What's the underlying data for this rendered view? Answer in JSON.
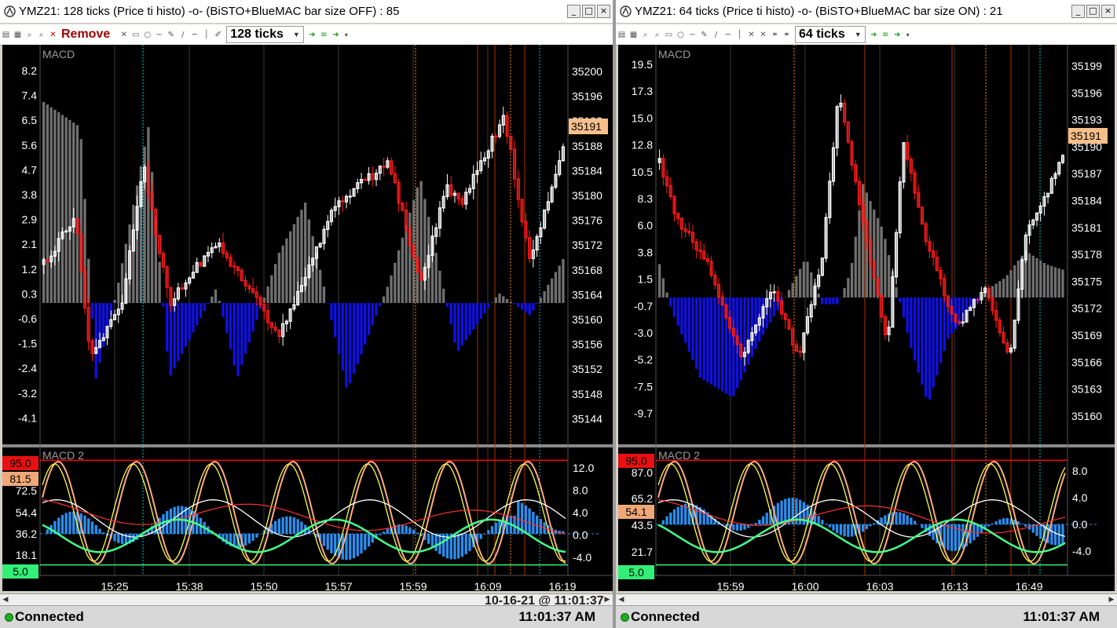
{
  "colors": {
    "bull": "#ffffff",
    "bear": "#ff1a1a",
    "hist_pos": "#707070",
    "hist_neg": "#1010e6",
    "hist2": "#2a8ef0",
    "grid": "#3a3a3a",
    "axis_text": "#ffffff",
    "price_tag_bg": "#f7c08a",
    "upper": "#ff0000",
    "lower": "#33ee77"
  },
  "windows": [
    {
      "title": "YMZ21: 128 ticks (Price  ti histo) -o- (BiSTO+BlueMAC bar size OFF) : 85",
      "remove_label": "Remove",
      "ticks_label": "128 ticks",
      "panel1_label": "MACD",
      "panel2_label": "MACD 2",
      "left_ticks": [
        "8.2",
        "7.4",
        "6.5",
        "5.6",
        "4.7",
        "3.8",
        "2.9",
        "2.1",
        "1.2",
        "0.3",
        "-0.6",
        "-1.5",
        "-2.4",
        "-3.2",
        "-4.1"
      ],
      "right_ticks": [
        "35200",
        "35196",
        "35192",
        "35188",
        "35184",
        "35180",
        "35176",
        "35172",
        "35168",
        "35164",
        "35160",
        "35156",
        "35152",
        "35148",
        "35144"
      ],
      "price_tag": "35191",
      "lower_left_ticks": [
        "95.0",
        "81.5",
        "72.5",
        "54.4",
        "36.2",
        "18.1",
        "5.0"
      ],
      "lower_right_ticks": [
        "12.0",
        "8.0",
        "4.0",
        "0.0",
        "-4.0"
      ],
      "time_ticks": [
        "15:25",
        "15:38",
        "15:50",
        "15:57",
        "15:59",
        "16:09",
        "16:19"
      ],
      "status": "Connected",
      "time": "11:01:37 AM"
    },
    {
      "title": "YMZ21: 64 ticks (Price  ti histo) -o- (BiSTO+BlueMAC bar size ON) : 21",
      "remove_label": "",
      "ticks_label": "64 ticks",
      "panel1_label": "MACD",
      "panel2_label": "MACD 2",
      "left_ticks": [
        "19.5",
        "17.3",
        "15.0",
        "12.8",
        "10.5",
        "8.3",
        "6.0",
        "3.8",
        "1.5",
        "-0.7",
        "-3.0",
        "-5.2",
        "-7.5",
        "-9.7"
      ],
      "right_ticks": [
        "35199",
        "35196",
        "35193",
        "35190",
        "35187",
        "35184",
        "35181",
        "35178",
        "35175",
        "35172",
        "35169",
        "35166",
        "35163",
        "35160"
      ],
      "price_tag": "35191",
      "lower_left_ticks": [
        "95.0",
        "87.0",
        "65.2",
        "54.1",
        "43.5",
        "21.7",
        "5.0"
      ],
      "lower_right_ticks": [
        "8.0",
        "4.0",
        "0.0",
        "-4.0"
      ],
      "time_ticks": [
        "15:59",
        "16:00",
        "16:03",
        "16:13",
        "16:49"
      ],
      "status": "Connected",
      "time": "11:01:37 AM"
    }
  ],
  "date_overlay": "10-16-21 @ 11:01:37"
}
